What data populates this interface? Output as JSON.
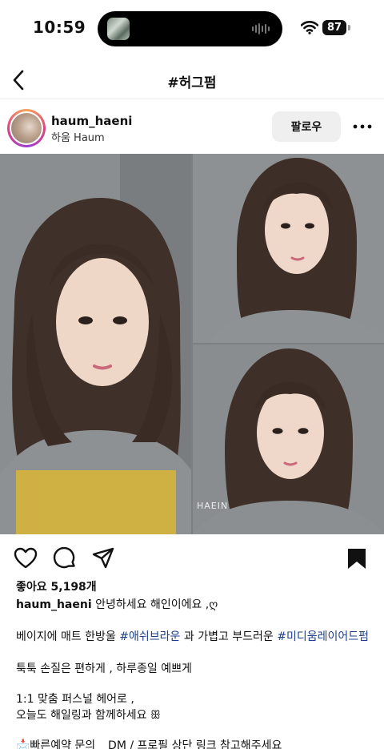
{
  "status": {
    "time": "10:59",
    "battery": "87"
  },
  "nav": {
    "title": "#허그펌"
  },
  "post": {
    "username": "haum_haeni",
    "subname": "하움 Haum",
    "follow_label": "팔로우",
    "watermark": "HAEIN",
    "likes": "좋아요 5,198개",
    "caption_user": "haum_haeni",
    "caption_first": "안녕하세요 해인이에요 ,ღ",
    "line2_a": "베이지에 매트 한방울 ",
    "line2_tag1": "#애쉬브라운",
    "line2_b": " 과 가볍고 부드러운 ",
    "line2_tag2": "#미디움레이어드펌",
    "line3": "툭툭 손질은 편하게 , 하루종일 예쁘게",
    "line4": "1:1 맞춤 퍼스널 헤어로 ,",
    "line5": "오늘도 해일링과 함께하세요 ꕥ",
    "line6": "📩빠른예약 문의 _ DM / 프로필 상단 링크 참고해주세요"
  },
  "icons": {
    "back": "chevron-left-icon",
    "more": "more-horizontal-icon",
    "like": "heart-icon",
    "comment": "comment-icon",
    "share": "send-icon",
    "save": "bookmark-icon",
    "tag": "user-tag-icon"
  },
  "colors": {
    "hashtag": "#1c3f87",
    "follow_bg": "#efefef"
  }
}
